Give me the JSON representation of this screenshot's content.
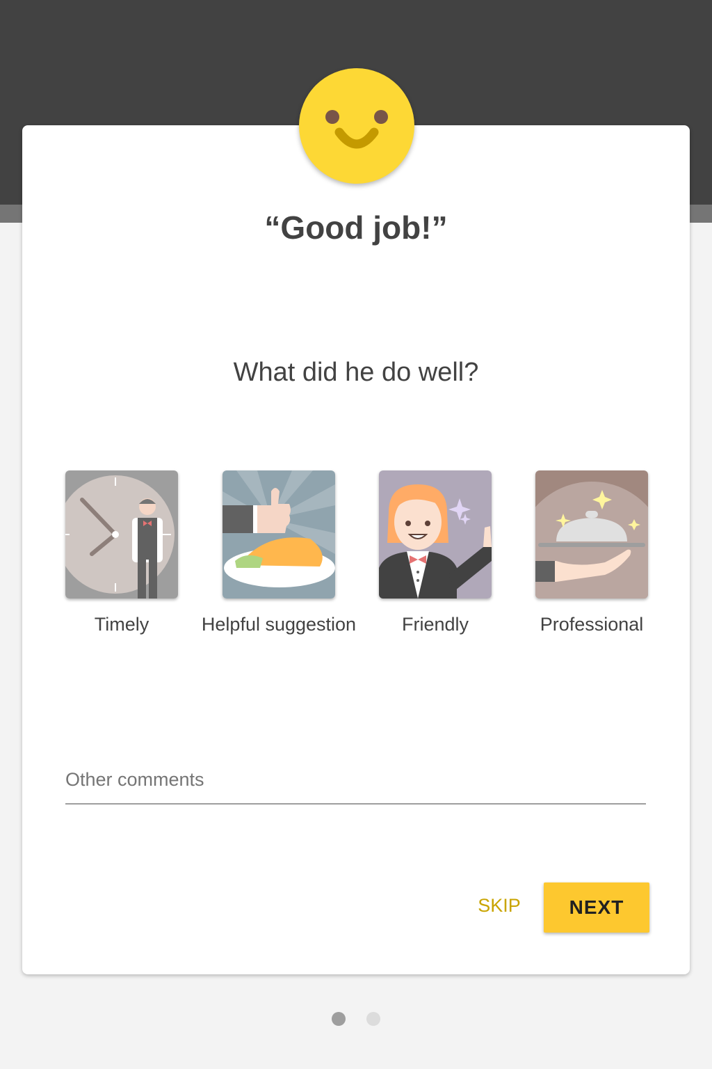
{
  "header": {
    "mood_icon": "smiley-icon",
    "title": "“Good job!”"
  },
  "prompt": {
    "question": "What did he do well?"
  },
  "options": [
    {
      "label": "Timely",
      "icon": "clock-waiter-icon"
    },
    {
      "label": "Helpful suggestion",
      "icon": "thumbs-up-dish-icon"
    },
    {
      "label": "Friendly",
      "icon": "friendly-waitress-icon"
    },
    {
      "label": "Professional",
      "icon": "serving-cloche-icon"
    }
  ],
  "comments": {
    "placeholder": "Other comments",
    "value": ""
  },
  "actions": {
    "skip_label": "SKIP",
    "next_label": "NEXT"
  },
  "pagination": {
    "current_page": 1,
    "total_pages": 2
  },
  "colors": {
    "header_background": "#424242",
    "accent": "#fdc82f",
    "skip_text": "#c9a400",
    "smiley": "#fdd835"
  }
}
